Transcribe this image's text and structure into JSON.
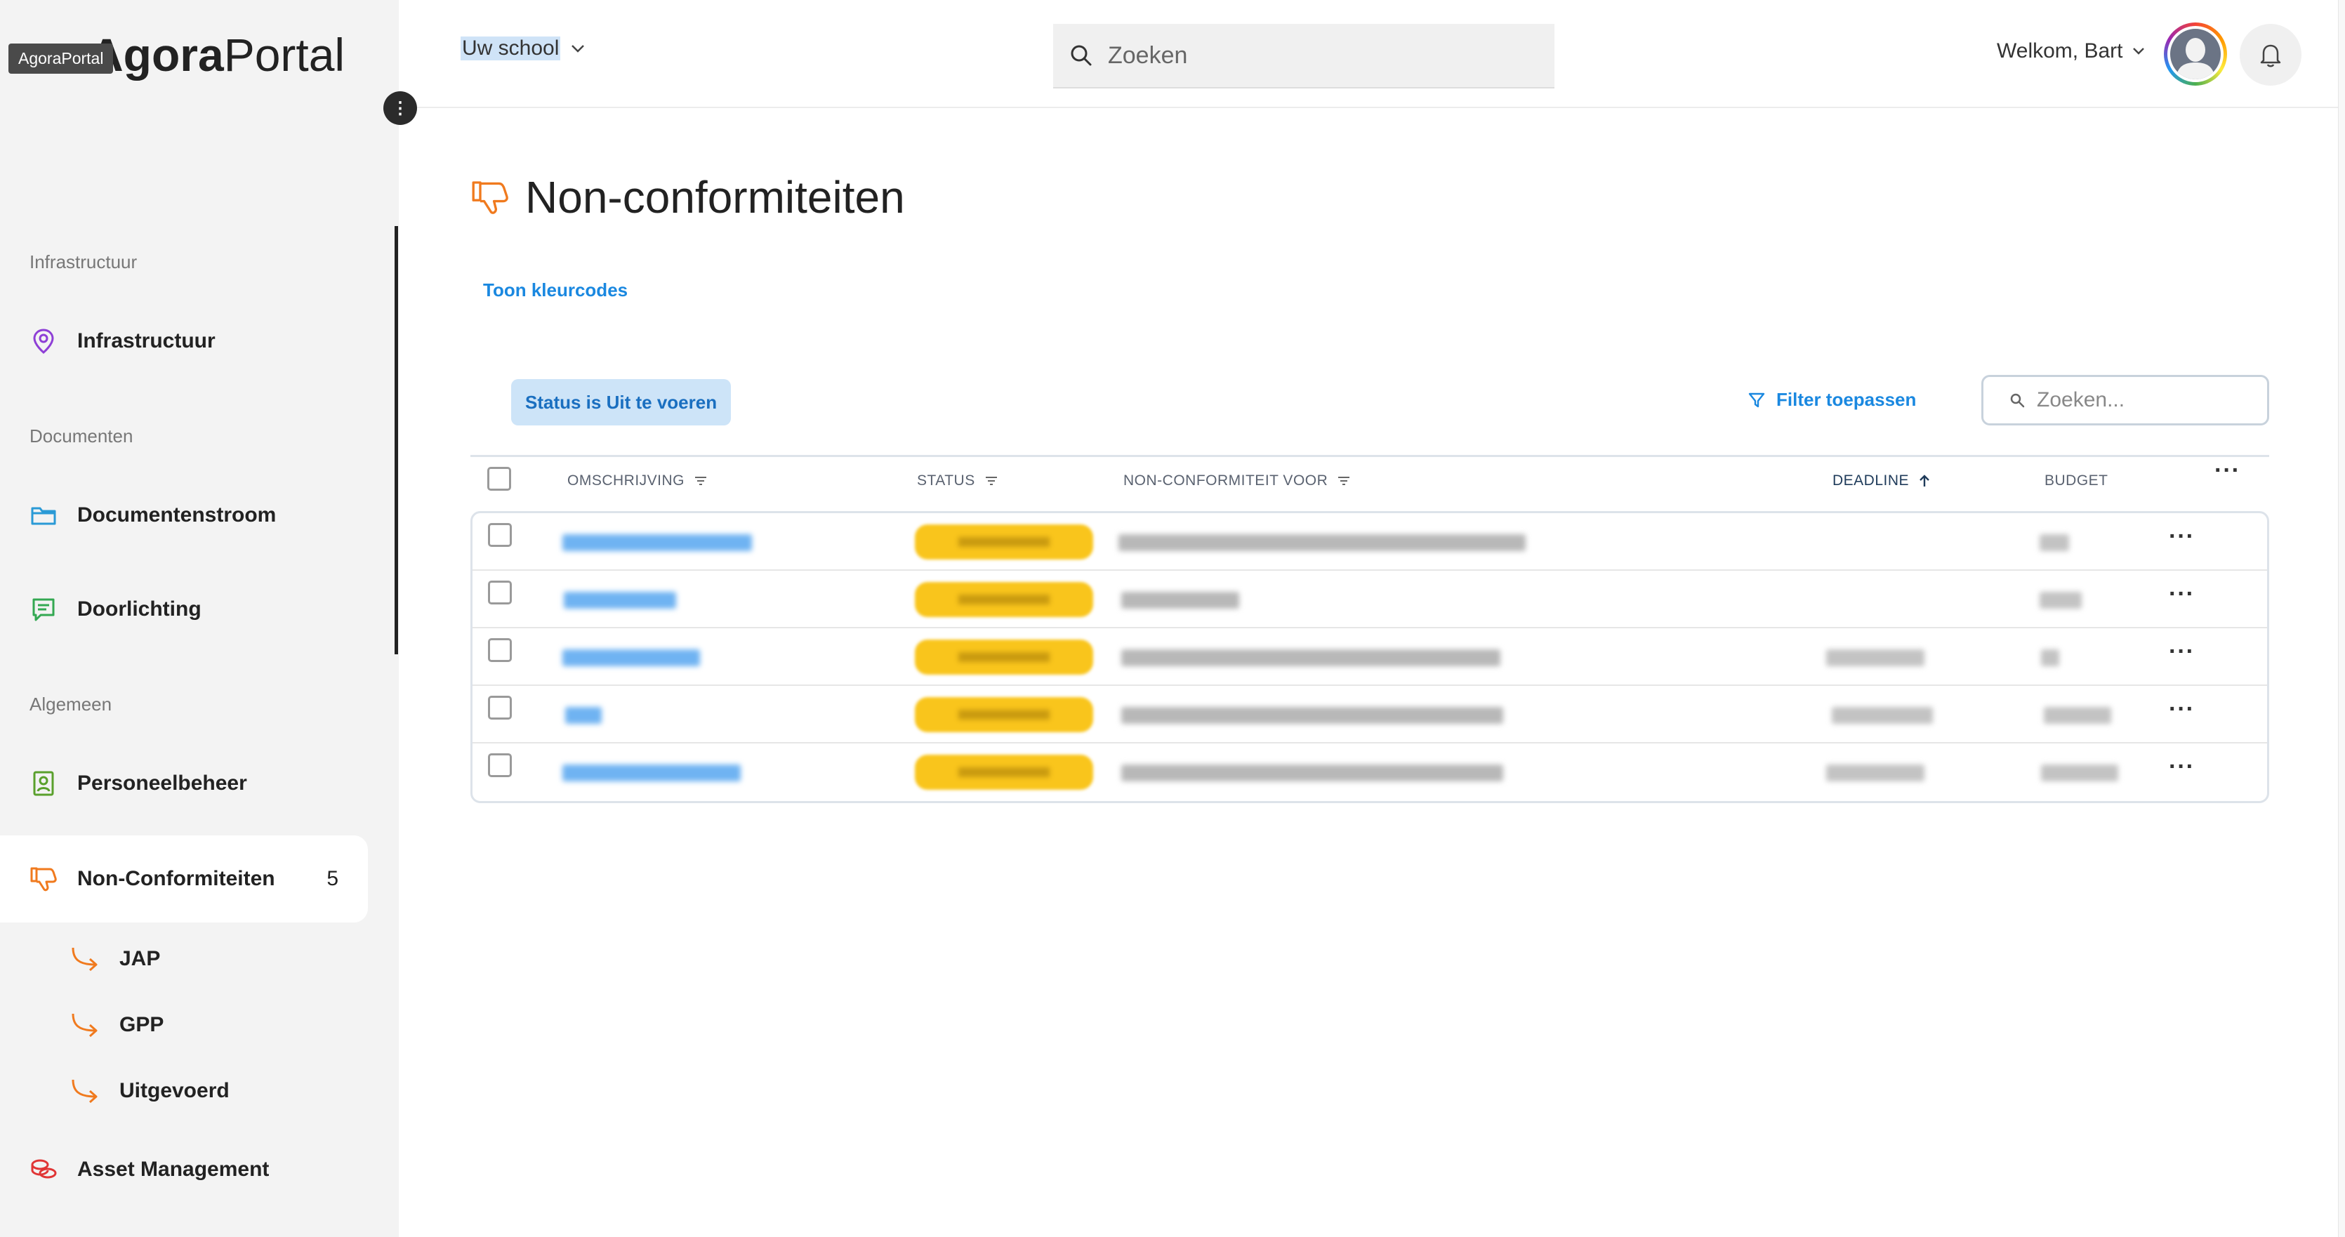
{
  "app": {
    "logo_bold": "Agora",
    "logo_light": "Portal",
    "logo_tooltip": "AgoraPortal"
  },
  "topbar": {
    "school_select_value": "Uw school",
    "search_placeholder": "Zoeken",
    "welcome_text": "Welkom, Bart"
  },
  "sidebar": {
    "sections": [
      {
        "title": "Infrastructuur",
        "items": [
          {
            "label": "Infrastructuur",
            "icon": "location-pin-icon"
          }
        ]
      },
      {
        "title": "Documenten",
        "items": [
          {
            "label": "Documentenstroom",
            "icon": "folder-icon"
          },
          {
            "label": "Doorlichting",
            "icon": "comment-icon"
          }
        ]
      },
      {
        "title": "Algemeen",
        "items": [
          {
            "label": "Personeelbeheer",
            "icon": "id-badge-icon"
          },
          {
            "label": "Non-Conformiteiten",
            "icon": "thumbs-down-icon",
            "count": "5",
            "active": true
          },
          {
            "label": "Asset Management",
            "icon": "coins-icon"
          }
        ]
      }
    ],
    "subitems": [
      "JAP",
      "GPP",
      "Uitgevoerd"
    ]
  },
  "main": {
    "title": "Non-conformiteiten",
    "color_toggle": "Toon kleurcodes",
    "status_chip": "Status is Uit te voeren",
    "filter_button": "Filter toepassen",
    "table_search_placeholder": "Zoeken...",
    "columns": [
      "OMSCHRIJVING",
      "STATUS",
      "NON-CONFORMITEIT VOOR",
      "DEADLINE",
      "BUDGET"
    ],
    "rows": [
      {
        "description": "redacted",
        "status": "Uit te voeren",
        "nc_for": "redacted",
        "deadline": "",
        "budget": "redacted"
      },
      {
        "description": "redacted",
        "status": "Uit te voeren",
        "nc_for": "redacted",
        "deadline": "",
        "budget": "redacted"
      },
      {
        "description": "redacted",
        "status": "Uit te voeren",
        "nc_for": "redacted",
        "deadline": "redacted",
        "budget": "redacted"
      },
      {
        "description": "redacted",
        "status": "Uit te voeren",
        "nc_for": "redacted",
        "deadline": "redacted",
        "budget": "redacted"
      },
      {
        "description": "redacted",
        "status": "Uit te voeren",
        "nc_for": "redacted",
        "deadline": "redacted",
        "budget": "redacted"
      }
    ]
  },
  "colors": {
    "accent_blue": "#1a88e0",
    "chip_bg": "#cde4f8",
    "status_yellow": "#f9c51c",
    "nc_orange": "#f07a1e",
    "sidebar_bg": "#f3f3f3"
  }
}
